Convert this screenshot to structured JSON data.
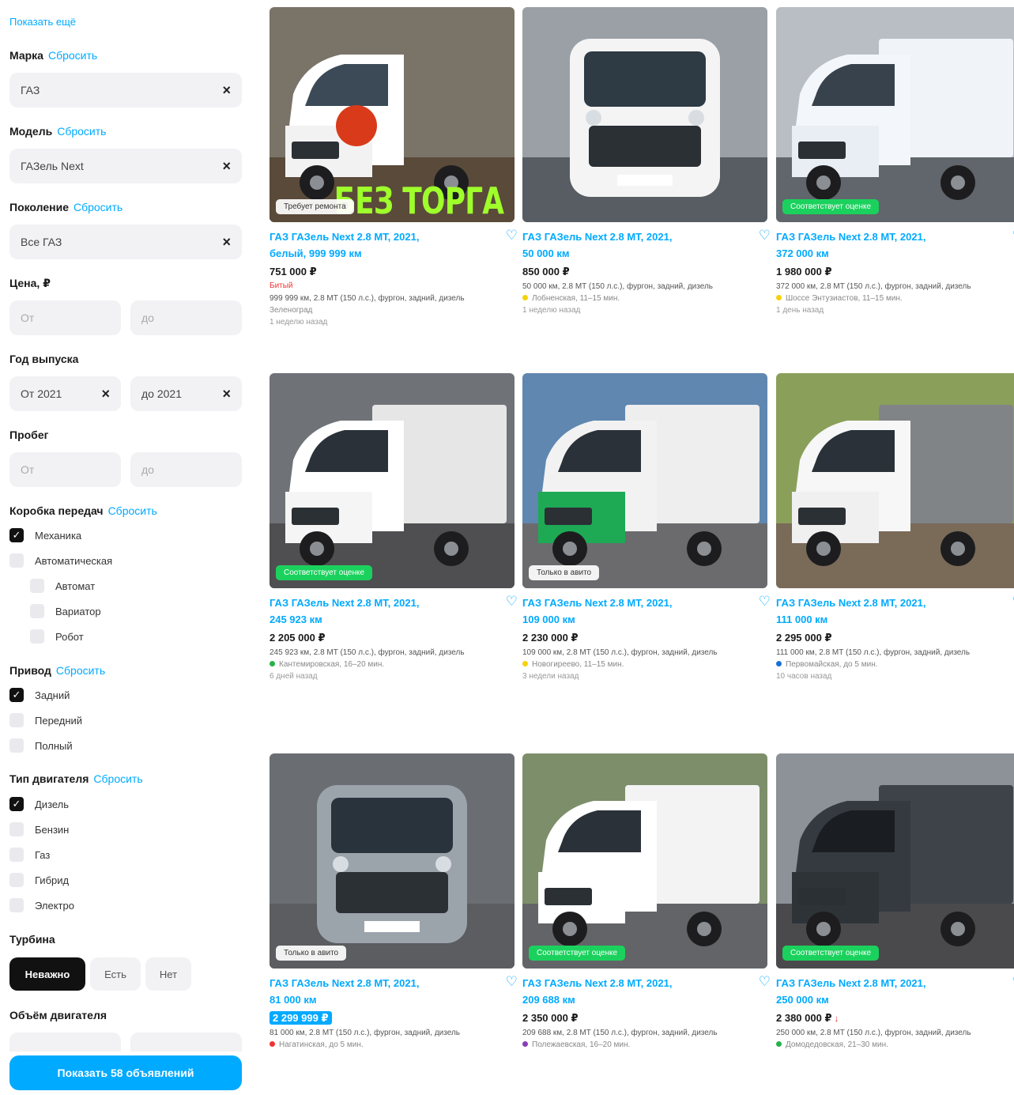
{
  "filters": {
    "show_more": "Показать ещё",
    "make": {
      "label": "Марка",
      "reset": "Сбросить",
      "value": "ГАЗ"
    },
    "model": {
      "label": "Модель",
      "reset": "Сбросить",
      "value": "ГАЗель Next"
    },
    "generation": {
      "label": "Поколение",
      "reset": "Сбросить",
      "value": "Все ГАЗ"
    },
    "price": {
      "label": "Цена, ₽",
      "from_ph": "От",
      "to_ph": "до"
    },
    "year": {
      "label": "Год выпуска",
      "from_value": "От 2021",
      "to_value": "до 2021"
    },
    "mileage": {
      "label": "Пробег",
      "from_ph": "От",
      "to_ph": "до"
    },
    "gearbox": {
      "label": "Коробка передач",
      "reset": "Сбросить",
      "options": [
        {
          "label": "Механика",
          "checked": true
        },
        {
          "label": "Автоматическая",
          "checked": false
        },
        {
          "label": "Автомат",
          "checked": false
        },
        {
          "label": "Вариатор",
          "checked": false
        },
        {
          "label": "Робот",
          "checked": false
        }
      ]
    },
    "drive": {
      "label": "Привод",
      "reset": "Сбросить",
      "options": [
        {
          "label": "Задний",
          "checked": true
        },
        {
          "label": "Передний",
          "checked": false
        },
        {
          "label": "Полный",
          "checked": false
        }
      ]
    },
    "engine_type": {
      "label": "Тип двигателя",
      "reset": "Сбросить",
      "options": [
        {
          "label": "Дизель",
          "checked": true
        },
        {
          "label": "Бензин",
          "checked": false
        },
        {
          "label": "Газ",
          "checked": false
        },
        {
          "label": "Гибрид",
          "checked": false
        },
        {
          "label": "Электро",
          "checked": false
        }
      ]
    },
    "turbo": {
      "label": "Турбина",
      "options": [
        "Неважно",
        "Есть",
        "Нет"
      ],
      "active": "Неважно"
    },
    "engine_volume": {
      "label": "Объём двигателя"
    },
    "show_button": "Показать 58 объявлений"
  },
  "listings": [
    {
      "title": "ГАЗ ГАЗель Next 2.8 MT, 2021,",
      "subtitle": "белый, 999 999 км",
      "price": "751 000 ₽",
      "color_note": "Битый",
      "desc": "999 999 км, 2.8 MT (150 л.с.), фургон, задний, дизель",
      "location": "Зеленоград",
      "time": "1 неделю назад",
      "badge": "Требует ремонта",
      "badge_style": "white",
      "overlay": "БЕЗ ТОРГА"
    },
    {
      "title": "ГАЗ ГАЗель Next 2.8 MT, 2021,",
      "subtitle": "50 000 км",
      "price": "850 000 ₽",
      "desc": "50 000 км, 2.8 MT (150 л.с.), фургон, задний, дизель",
      "metro": "Лобненская, 11–15 мин.",
      "metro_color": "#f5d20a",
      "time": "1 неделю назад"
    },
    {
      "title": "ГАЗ ГАЗель Next 2.8 MT, 2021,",
      "subtitle": "372 000 км",
      "price": "1 980 000 ₽",
      "desc": "372 000 км, 2.8 MT (150 л.с.), фургон, задний, дизель",
      "metro": "Шоссе Энтузиастов, 11–15 мин.",
      "metro_color": "#f5d20a",
      "time": "1 день назад",
      "badge": "Соответствует оценке",
      "badge_style": "green"
    },
    {
      "title": "ГАЗ ГАЗель Next 2.8 MT, 2021,",
      "subtitle": "245 923 км",
      "price": "2 205 000 ₽",
      "desc": "245 923 км, 2.8 MT (150 л.с.), фургон, задний, дизель",
      "metro": "Кантемировская, 16–20 мин.",
      "metro_color": "#26b24b",
      "time": "6 дней назад",
      "badge": "Соответствует оценке",
      "badge_style": "green"
    },
    {
      "title": "ГАЗ ГАЗель Next 2.8 MT, 2021,",
      "subtitle": "109 000 км",
      "price": "2 230 000 ₽",
      "desc": "109 000 км, 2.8 MT (150 л.с.), фургон, задний, дизель",
      "metro": "Новогиреево, 11–15 мин.",
      "metro_color": "#f5d20a",
      "time": "3 недели назад",
      "badge": "Только в авито",
      "badge_style": "white"
    },
    {
      "title": "ГАЗ ГАЗель Next 2.8 MT, 2021,",
      "subtitle": "111 000 км",
      "price": "2 295 000 ₽",
      "desc": "111 000 км, 2.8 MT (150 л.с.), фургон, задний, дизель",
      "metro": "Первомайская, до 5 мин.",
      "metro_color": "#1a6fd6",
      "time": "10 часов назад"
    },
    {
      "title": "ГАЗ ГАЗель Next 2.8 MT, 2021,",
      "subtitle": "81 000 км",
      "price": "2 299 999 ₽",
      "price_highlight": true,
      "desc": "81 000 км, 2.8 MT (150 л.с.), фургон, задний, дизель",
      "metro": "Нагатинская, до 5 мин.",
      "metro_color": "#e33",
      "badge": "Только в авито",
      "badge_style": "white"
    },
    {
      "title": "ГАЗ ГАЗель Next 2.8 MT, 2021,",
      "subtitle": "209 688 км",
      "price": "2 350 000 ₽",
      "desc": "209 688 км, 2.8 MT (150 л.с.), фургон, задний, дизель",
      "metro": "Полежаевская, 16–20 мин.",
      "metro_color": "#8a3fb5",
      "badge": "Соответствует оценке",
      "badge_style": "green"
    },
    {
      "title": "ГАЗ ГАЗель Next 2.8 MT, 2021,",
      "subtitle": "250 000 км",
      "price": "2 380 000 ₽",
      "price_down": "↓",
      "desc": "250 000 км, 2.8 MT (150 л.с.), фургон, задний, дизель",
      "metro": "Домодедовская, 21–30 мин.",
      "metro_color": "#26b24b",
      "badge": "Соответствует оценке",
      "badge_style": "green"
    }
  ],
  "heart_glyph": "♡",
  "clear_glyph": "×",
  "check_glyph": "✓",
  "colors": {
    "accent": "#00aaff",
    "badge_green": "#1bd15d",
    "dark": "#111111"
  }
}
